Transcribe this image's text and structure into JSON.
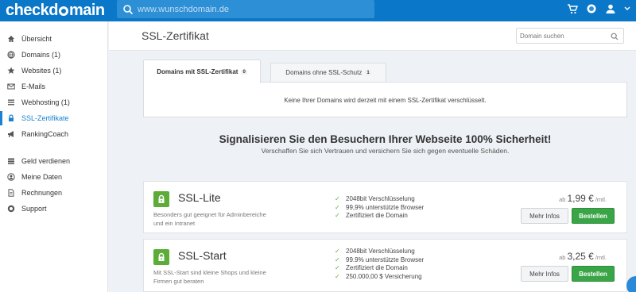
{
  "brand": {
    "logo_pre": "checkd",
    "logo_post": "main"
  },
  "top_search": {
    "placeholder": "www.wunschdomain.de"
  },
  "top_icons": [
    "cart-icon",
    "globe-icon",
    "user-icon",
    "chevron-down-icon"
  ],
  "sidebar": {
    "items": [
      {
        "label": "Übersicht",
        "icon": "home-icon"
      },
      {
        "label": "Domains (1)",
        "icon": "globe-icon"
      },
      {
        "label": "Websites (1)",
        "icon": "star-icon"
      },
      {
        "label": "E-Mails",
        "icon": "mail-icon"
      },
      {
        "label": "Webhosting (1)",
        "icon": "list-icon"
      },
      {
        "label": "SSL-Zertifikate",
        "icon": "lock-icon",
        "active": true
      },
      {
        "label": "RankingCoach",
        "icon": "megaphone-icon"
      }
    ],
    "items2": [
      {
        "label": "Geld verdienen",
        "icon": "money-icon"
      },
      {
        "label": "Meine Daten",
        "icon": "user-circle-icon"
      },
      {
        "label": "Rechnungen",
        "icon": "document-icon"
      },
      {
        "label": "Support",
        "icon": "support-icon"
      }
    ]
  },
  "page": {
    "title": "SSL-Zertifikat",
    "domain_search_placeholder": "Domain suchen",
    "tabs": [
      {
        "label": "Domains mit SSL-Zertifikat",
        "count": "0"
      },
      {
        "label": "Domains ohne SSL-Schutz",
        "count": "1"
      }
    ],
    "info_text": "Keine Ihrer Domains wird derzeit mit einem SSL-Zertifikat verschlüsselt.",
    "promo_title": "Signalisieren Sie den Besuchern Ihrer Webseite 100% Sicherheit!",
    "promo_subtitle": "Verschaffen Sie sich Vertrauen und versichern Sie sich gegen eventuelle Schäden."
  },
  "products": [
    {
      "name": "SSL-Lite",
      "description": "Besonders gut geeignet für Adminbereiche und ein Intranet",
      "features": [
        "2048bit Verschlüsselung",
        "99,9% unterstützte Browser",
        "Zertifiziert die Domain"
      ],
      "price_prefix": "ab",
      "price": "1,99 €",
      "price_suffix": "/mtl.",
      "info_label": "Mehr Infos",
      "buy_label": "Bestellen"
    },
    {
      "name": "SSL-Start",
      "description": "Mit SSL-Start sind kleine Shops und kleine Firmen gut beraten",
      "features": [
        "2048bit Verschlüsselung",
        "99.9% unterstützte Browser",
        "Zertifiziert die Domain",
        "250.000,00 $ Versicherung"
      ],
      "price_prefix": "ab",
      "price": "3,25 €",
      "price_suffix": "/mtl.",
      "info_label": "Mehr Infos",
      "buy_label": "Bestellen"
    }
  ],
  "colors": {
    "topbar": "#0a77c8",
    "accent": "#1a82d0",
    "buy": "#3aa547"
  }
}
